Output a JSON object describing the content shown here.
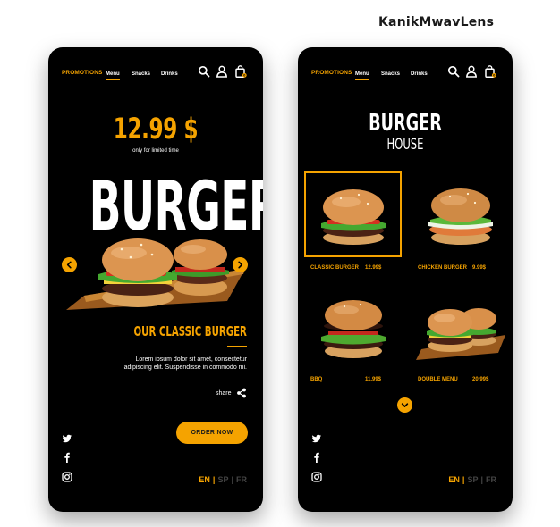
{
  "credit": "KanikMwavLens",
  "colors": {
    "accent": "#f5a300",
    "background": "#000000",
    "text": "#ffffff"
  },
  "nav": {
    "promotions": "PROMOTIONS",
    "menu": "Menu",
    "snacks": "Snacks",
    "drinks": "Drinks",
    "cart_count": "0",
    "icons": [
      "search-icon",
      "user-icon",
      "shopping-bag-icon"
    ]
  },
  "left": {
    "price": "12.99 $",
    "price_note": "only for limited time",
    "big_word": "BURGER",
    "dish_title": "OUR CLASSIC BURGER",
    "description": "Lorem ipsum dolor sit amet, consectetur adipiscing elit. Suspendisse in commodo mi.",
    "share": "share",
    "order_button": "ORDER NOW"
  },
  "right": {
    "title": "BURGER",
    "subtitle": "HOUSE",
    "items": [
      {
        "name": "CLASSIC BURGER",
        "price": "12.99$",
        "selected": true
      },
      {
        "name": "CHICKEN BURGER",
        "price": "9.99$",
        "selected": false
      },
      {
        "name": "BBQ",
        "price": "11.99$",
        "selected": false
      },
      {
        "name": "DOUBLE MENU",
        "price": "20.99$",
        "selected": false
      }
    ]
  },
  "languages": {
    "active": "EN",
    "others": [
      "SP",
      "FR"
    ],
    "separator": "|"
  },
  "social": [
    "twitter-icon",
    "facebook-icon",
    "instagram-icon"
  ]
}
